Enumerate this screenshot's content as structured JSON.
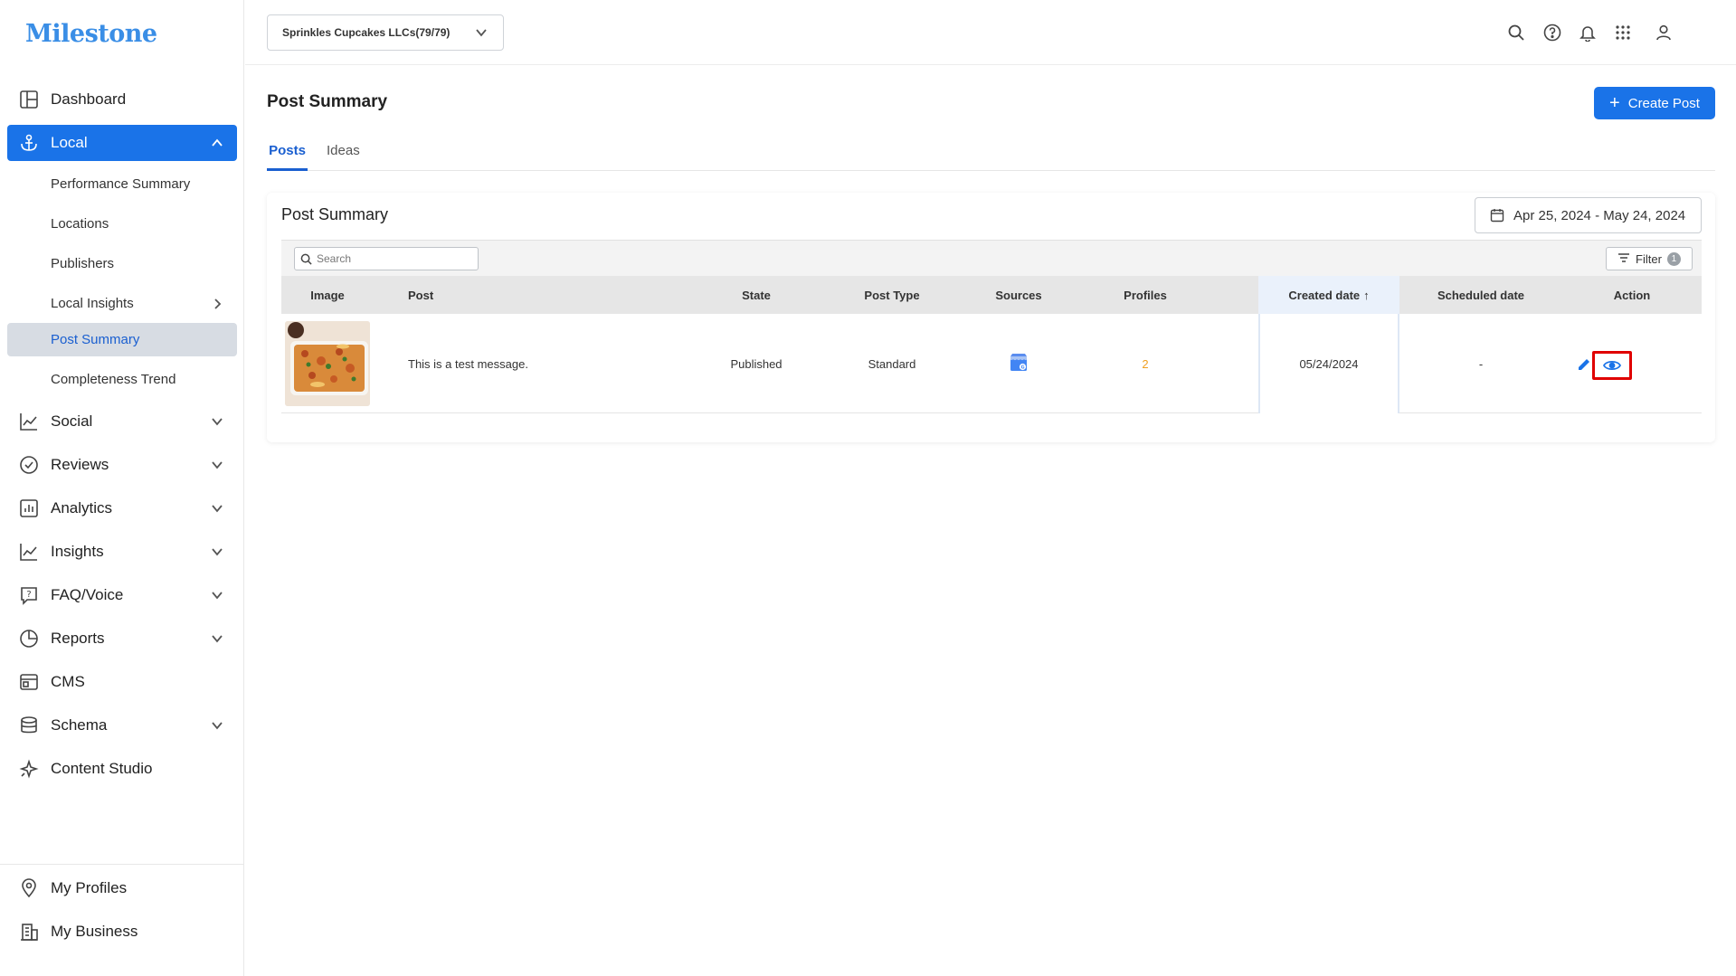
{
  "app": {
    "logo_text": "Milestone"
  },
  "sidebar": {
    "items": [
      {
        "label": "Dashboard",
        "icon": "dashboard-icon"
      },
      {
        "label": "Local",
        "icon": "anchor-icon",
        "expanded": true,
        "active": true
      },
      {
        "label": "Social",
        "icon": "line-chart-icon"
      },
      {
        "label": "Reviews",
        "icon": "check-circle-icon"
      },
      {
        "label": "Analytics",
        "icon": "bar-chart-icon"
      },
      {
        "label": "Insights",
        "icon": "line-chart-icon"
      },
      {
        "label": "FAQ/Voice",
        "icon": "faq-icon"
      },
      {
        "label": "Reports",
        "icon": "pie-chart-icon"
      },
      {
        "label": "CMS",
        "icon": "cms-icon"
      },
      {
        "label": "Schema",
        "icon": "database-icon"
      },
      {
        "label": "Content Studio",
        "icon": "sparkle-icon"
      }
    ],
    "local_sub_items": [
      {
        "label": "Performance Summary"
      },
      {
        "label": "Locations"
      },
      {
        "label": "Publishers"
      },
      {
        "label": "Local Insights"
      },
      {
        "label": "Post Summary",
        "selected": true
      },
      {
        "label": "Completeness Trend"
      }
    ],
    "bottom_items": [
      {
        "label": "My Profiles",
        "icon": "location-pin-icon"
      },
      {
        "label": "My Business",
        "icon": "business-icon"
      }
    ]
  },
  "topbar": {
    "org_selector_value": "Sprinkles Cupcakes LLCs(79/79)",
    "icons": [
      "search-icon",
      "help-icon",
      "bell-icon",
      "apps-grid-icon",
      "user-icon"
    ]
  },
  "page": {
    "title": "Post Summary",
    "create_button_label": "Create Post",
    "tabs": [
      {
        "label": "Posts",
        "active": true
      },
      {
        "label": "Ideas"
      }
    ]
  },
  "card": {
    "title": "Post Summary",
    "date_range": "Apr 25, 2024 - May 24, 2024",
    "search_placeholder": "Search",
    "filter_label": "Filter",
    "filter_count": "1",
    "columns": [
      "Image",
      "Post",
      "State",
      "Post Type",
      "Sources",
      "Profiles",
      "Created date",
      "Scheduled date",
      "Action"
    ],
    "sort_indicator": "↑",
    "rows": [
      {
        "post": "This is a test message.",
        "state": "Published",
        "post_type": "Standard",
        "source_icon": "google-business-icon",
        "profiles": "2",
        "created_date": "05/24/2024",
        "scheduled_date": "-",
        "actions": [
          "edit-icon",
          "view-eye-icon"
        ]
      }
    ]
  },
  "colors": {
    "primary": "#1a73e8",
    "highlight": "#e00000",
    "profiles_count": "#f0a020"
  }
}
